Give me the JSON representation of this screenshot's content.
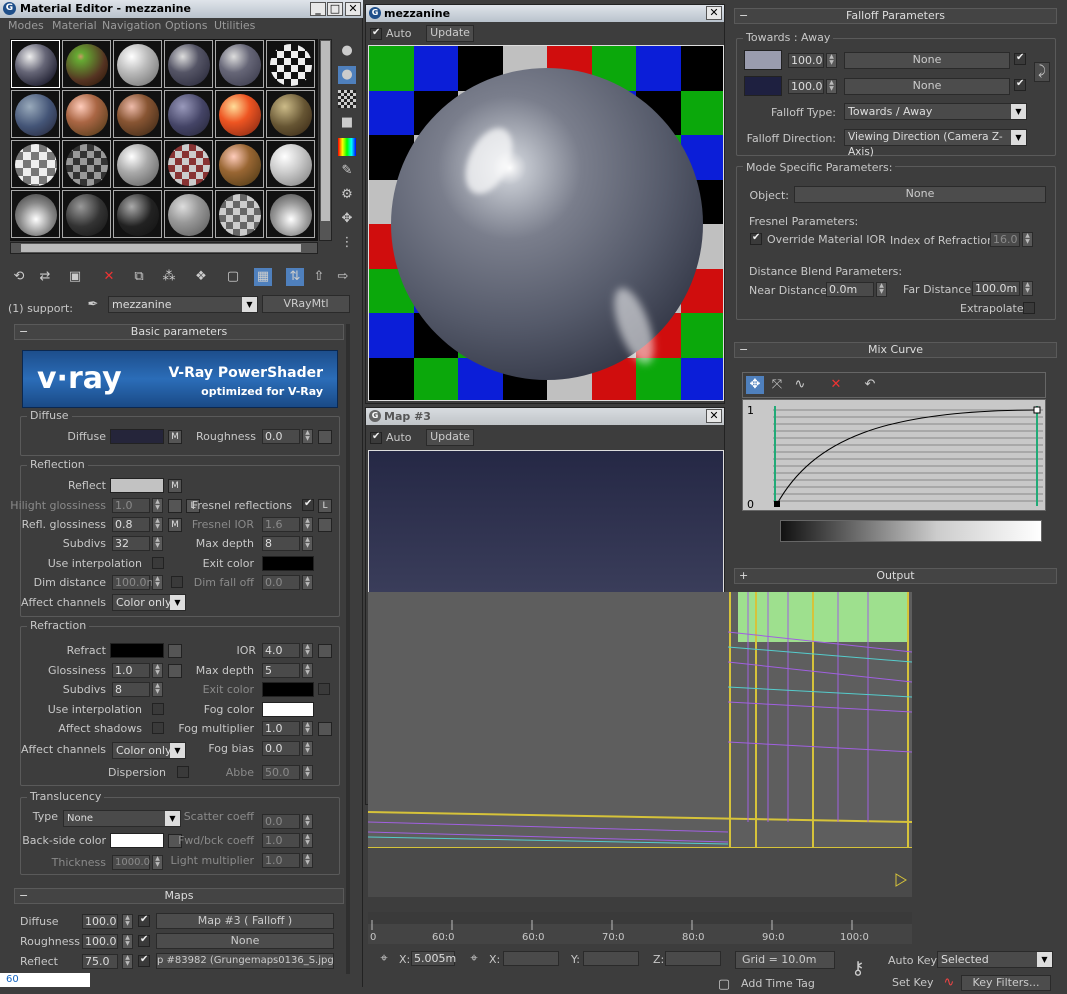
{
  "material_editor": {
    "title": "Material Editor - mezzanine",
    "menu": [
      "Modes",
      "Material",
      "Navigation",
      "Options",
      "Utilities"
    ],
    "support_label": "(1) support:",
    "material_name": "mezzanine",
    "material_type": "VRayMtl",
    "basic_params": "Basic parameters",
    "vray_logo": "v·ray",
    "vray_title": "V-Ray PowerShader",
    "vray_sub": "optimized for V-Ray",
    "diffuse_group": "Diffuse",
    "diffuse_label": "Diffuse",
    "roughness_label": "Roughness",
    "roughness_val": "0.0",
    "m": "M",
    "l": "L",
    "reflection_group": "Reflection",
    "reflect_label": "Reflect",
    "hilight_label": "Hilight glossiness",
    "hilight_val": "1.0",
    "fresnel_label": "Fresnel reflections",
    "refl_gloss_label": "Refl. glossiness",
    "refl_gloss_val": "0.8",
    "fresnel_ior_label": "Fresnel IOR",
    "fresnel_ior_val": "1.6",
    "subdivs_label": "Subdivs",
    "subdivs_val": "32",
    "max_depth_label": "Max depth",
    "max_depth_val": "8",
    "use_interp_label": "Use interpolation",
    "exit_color_label": "Exit color",
    "dim_dist_label": "Dim distance",
    "dim_dist_val": "100.0m",
    "dim_falloff_label": "Dim fall off",
    "dim_falloff_val": "0.0",
    "affect_channels_label": "Affect channels",
    "affect_channels_val": "Color only",
    "refraction_group": "Refraction",
    "refract_label": "Refract",
    "ior_label": "IOR",
    "ior_val": "4.0",
    "glossiness_label": "Glossiness",
    "glossiness_val": "1.0",
    "r_max_depth_val": "5",
    "r_subdivs_val": "8",
    "affect_shadows_label": "Affect shadows",
    "fog_color_label": "Fog color",
    "fog_mult_label": "Fog multiplier",
    "fog_mult_val": "1.0",
    "fog_bias_label": "Fog bias",
    "fog_bias_val": "0.0",
    "dispersion_label": "Dispersion",
    "abbe_label": "Abbe",
    "abbe_val": "50.0",
    "translucency_group": "Translucency",
    "type_label": "Type",
    "type_val": "None",
    "scatter_label": "Scatter coeff",
    "scatter_val": "0.0",
    "backside_label": "Back-side color",
    "fwd_label": "Fwd/bck coeff",
    "fwd_val": "1.0",
    "thickness_label": "Thickness",
    "thickness_val": "1000.0",
    "light_mult_label": "Light multiplier",
    "light_mult_val": "1.0",
    "maps_rollout": "Maps",
    "maps": [
      {
        "label": "Diffuse",
        "amount": "100.0",
        "map": "Map #3  ( Falloff )"
      },
      {
        "label": "Roughness",
        "amount": "100.0",
        "map": "None"
      },
      {
        "label": "Reflect",
        "amount": "75.0",
        "map": "p #83982 (Grungemaps0136_S.jpg)"
      }
    ],
    "bottom_num": "60"
  },
  "preview1": {
    "title": "mezzanine",
    "auto": "Auto",
    "update": "Update"
  },
  "preview2": {
    "title": "Map #3",
    "auto": "Auto",
    "update": "Update"
  },
  "falloff": {
    "rollout": "Falloff Parameters",
    "group": "Towards : Away",
    "val1": "100.0",
    "val2": "100.0",
    "none": "None",
    "type_label": "Falloff Type:",
    "type_val": "Towards / Away",
    "dir_label": "Falloff Direction:",
    "dir_val": "Viewing Direction (Camera Z-Axis)",
    "mode_group": "Mode Specific Parameters:",
    "object_label": "Object:",
    "object_val": "None",
    "fresnel_group": "Fresnel Parameters:",
    "override_label": "Override Material IOR",
    "ior_label": "Index of Refraction",
    "ior_val": "16.0",
    "blend_group": "Distance Blend Parameters:",
    "near_label": "Near Distance:",
    "near_val": "0.0m",
    "far_label": "Far Distance:",
    "far_val": "100.0m",
    "extrapolate_label": "Extrapolate",
    "mix_curve": "Mix Curve",
    "curve_top": "1",
    "curve_bottom": "0",
    "output": "Output"
  },
  "timeline": {
    "ticks": [
      "0",
      "60:0",
      "60:0",
      "70:0",
      "80:0",
      "90:0",
      "100:0"
    ]
  },
  "status": {
    "x_label": "X:",
    "x_val": "5.005m",
    "x2_label": "X:",
    "y_label": "Y:",
    "z_label": "Z:",
    "grid": "Grid = 10.0m",
    "auto_key": "Auto Key",
    "selected": "Selected",
    "set_key": "Set Key",
    "key_filters": "Key Filters...",
    "add_time_tag": "Add Time Tag"
  },
  "colors": {
    "accent": "#3b6fb6",
    "diffuse_swatch": "#25253a",
    "reflect_swatch": "#c2c2c2",
    "falloff1": "#9a9cae",
    "falloff2": "#1e2040"
  }
}
